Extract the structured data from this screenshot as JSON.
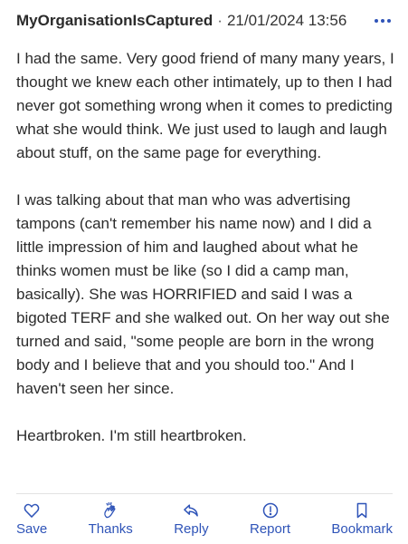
{
  "post": {
    "username": "MyOrganisationIsCaptured",
    "separator": "·",
    "timestamp": "21/01/2024 13:56",
    "paragraphs": [
      "I had the same. Very good friend of many many years, I thought we knew each other intimately, up to then I had never got something wrong when it comes to predicting what she would think. We just used to laugh and laugh about stuff, on the same page for everything.",
      "I was talking about that man who was advertising tampons (can't remember his name now) and I did a little impression of him and laughed about what he thinks women must be like (so I did a camp man, basically). She was HORRIFIED and said I was a bigoted TERF and she walked out. On her way out she turned and said, \"some people are born in the wrong body and I believe that and you should too.\" And I haven't seen her since.",
      "Heartbroken. I'm still heartbroken."
    ]
  },
  "actions": {
    "save": {
      "label": "Save",
      "icon": "heart-icon"
    },
    "thanks": {
      "label": "Thanks",
      "icon": "clap-icon"
    },
    "reply": {
      "label": "Reply",
      "icon": "reply-arrow-icon"
    },
    "report": {
      "label": "Report",
      "icon": "exclamation-circle-icon"
    },
    "bookmark": {
      "label": "Bookmark",
      "icon": "bookmark-icon"
    }
  },
  "colors": {
    "accent": "#2f54b8",
    "text": "#2b2b2b",
    "divider": "#e2e2e2"
  }
}
